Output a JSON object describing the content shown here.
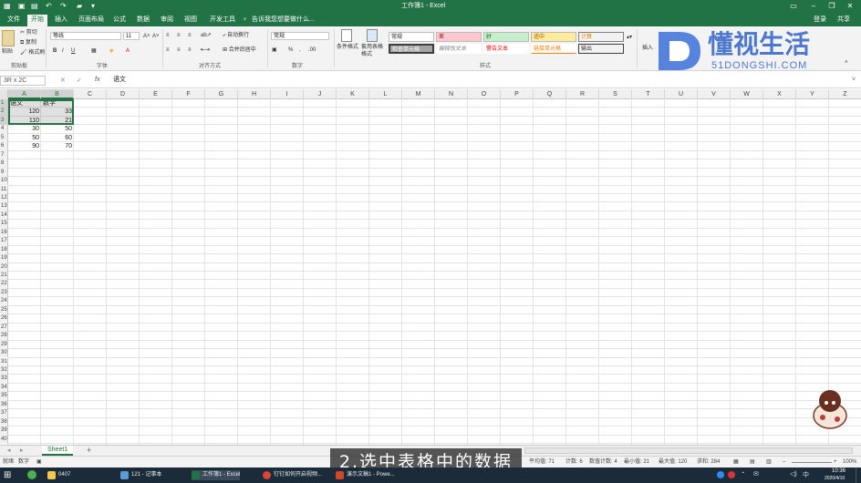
{
  "titlebar": {
    "title": "工作簿1 - Excel",
    "login": "登录",
    "share": "共享"
  },
  "tabs": [
    "文件",
    "开始",
    "插入",
    "页面布局",
    "公式",
    "数据",
    "审阅",
    "视图",
    "开发工具"
  ],
  "search_hint": "告诉我您想要做什么...",
  "ribbon": {
    "clipboard": {
      "cut": "剪切",
      "copy": "复制",
      "paste": "粘贴",
      "format_painter": "格式刷",
      "label": "剪贴板"
    },
    "font": {
      "name": "等线",
      "size": "11",
      "label": "字体"
    },
    "alignment": {
      "wrap": "自动换行",
      "merge": "合并后居中",
      "label": "对齐方式"
    },
    "number": {
      "format": "常规",
      "label": "数字"
    },
    "styles": {
      "cond_format": "条件格式",
      "table_format": "套用表格格式",
      "label": "样式",
      "cells": [
        "常规",
        "差",
        "好",
        "适中",
        "计算",
        "检查单元格",
        "解释性文本",
        "警告文本",
        "链接单元格",
        "输出"
      ]
    },
    "cells_group": {
      "insert": "插入"
    }
  },
  "formulabar": {
    "namebox": "3R x 2C",
    "fx": "fx",
    "value": "语文"
  },
  "columns": [
    "A",
    "B",
    "C",
    "D",
    "E",
    "F",
    "G",
    "H",
    "I",
    "J",
    "K",
    "L",
    "M",
    "N",
    "O",
    "P",
    "Q",
    "R",
    "S",
    "T",
    "U",
    "V",
    "W",
    "X",
    "Y",
    "Z"
  ],
  "rows": [
    "1",
    "2",
    "3",
    "4",
    "5",
    "6",
    "7",
    "8",
    "9",
    "10",
    "11",
    "12",
    "13",
    "14",
    "15",
    "16",
    "17",
    "18",
    "19",
    "20",
    "21",
    "22",
    "23",
    "24",
    "25",
    "26",
    "27",
    "28",
    "29",
    "30",
    "31",
    "32",
    "33",
    "34",
    "35",
    "36",
    "37",
    "38",
    "39",
    "40"
  ],
  "table": {
    "headers": [
      "语文",
      "数学"
    ],
    "rows": [
      [
        "120",
        "33"
      ],
      [
        "110",
        "21"
      ],
      [
        "30",
        "50"
      ],
      [
        "50",
        "60"
      ],
      [
        "90",
        "70"
      ]
    ]
  },
  "sheet": {
    "tab": "Sheet1",
    "add": "+"
  },
  "status": {
    "ready": "就绪",
    "num": "数字",
    "average": "平均值: 71",
    "count": "计数: 6",
    "num_count": "数值计数: 4",
    "min": "最小值: 21",
    "max": "最大值: 120",
    "sum": "求和: 284",
    "zoom": "100%"
  },
  "taskbar": {
    "items": [
      "0407",
      "121 - 记事本",
      "工作簿1 - Excel",
      "钉钉如何开启视频...",
      "演示文稿1 - Powe..."
    ],
    "time": "10:36",
    "date": "2020/4/10",
    "ime": "中"
  },
  "caption": "2.选中表格中的数据",
  "watermark": {
    "brand": "懂视生活",
    "domain": "51DONGSHI.COM"
  },
  "colors": {
    "excel_green": "#217346",
    "taskbar": "#1c2b3a"
  }
}
